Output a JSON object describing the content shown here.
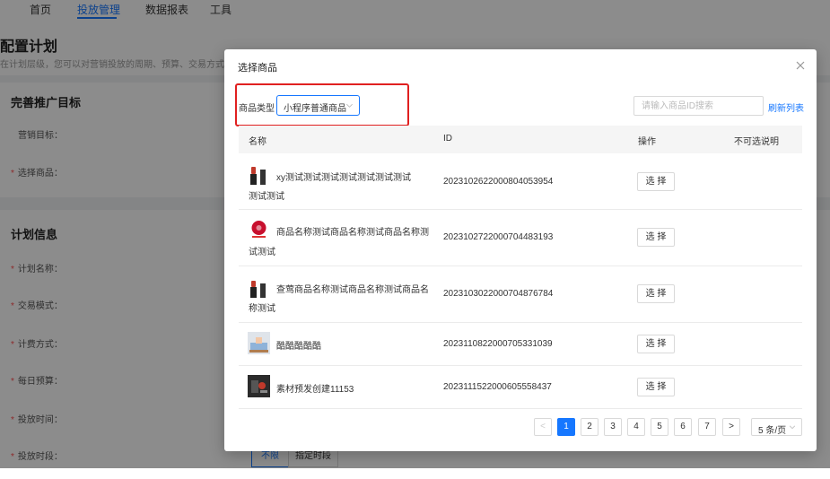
{
  "nav": {
    "items": [
      "首页",
      "投放管理",
      "数据报表",
      "工具"
    ],
    "active_index": 1
  },
  "page": {
    "title": "配置计划",
    "description": "在计划层级，您可以对营销投放的周期、预算、交易方式等进行"
  },
  "section1": {
    "title": "完善推广目标",
    "labels": [
      "营销目标：",
      "选择商品："
    ],
    "required": [
      false,
      true
    ]
  },
  "section2": {
    "title": "计划信息",
    "labels": [
      "计划名称：",
      "交易模式：",
      "计费方式：",
      "每日预算：",
      "投放时间：",
      "投放时段："
    ],
    "time_options": [
      "不限",
      "指定时段"
    ],
    "time_selected": "不限"
  },
  "modal": {
    "title": "选择商品",
    "filter_label": "商品类型",
    "product_type": "小程序普通商品",
    "search_placeholder": "请输入商品ID搜索",
    "refresh_label": "刷新列表",
    "columns": [
      "名称",
      "ID",
      "操作",
      "不可选说明"
    ],
    "rows": [
      {
        "name_line1": "xy测试测试测试测试测试测试测试",
        "name_line2": "测试测试",
        "id": "2023102622000804053954",
        "action": "选 择",
        "thumb": "lipstick-icon"
      },
      {
        "name_line1": "商品名称测试商品名称测试商品名称测",
        "name_line2": "试测试",
        "id": "2023102722000704483193",
        "action": "选 择",
        "thumb": "red-flower-logo"
      },
      {
        "name_line1": "查莺商品名称测试商品名称测试商品名",
        "name_line2": "称测试",
        "id": "2023103022000704876784",
        "action": "选 择",
        "thumb": "lipstick-icon"
      },
      {
        "name_line1": "酷酷酷酷酷",
        "name_line2": "",
        "id": "2023110822000705331039",
        "action": "选 择",
        "thumb": "room-photo"
      },
      {
        "name_line1": "素材预发创建11153",
        "name_line2": "",
        "id": "2023111522000605558437",
        "action": "选 择",
        "thumb": "dark-photo"
      }
    ],
    "pagination": {
      "prev": "<",
      "pages": [
        "1",
        "2",
        "3",
        "4",
        "5",
        "6",
        "7"
      ],
      "current": "1",
      "next": ">",
      "page_size": "5 条/页"
    }
  },
  "colors": {
    "primary": "#1677ff",
    "highlight": "#e02020",
    "required": "#ff4d4f"
  }
}
